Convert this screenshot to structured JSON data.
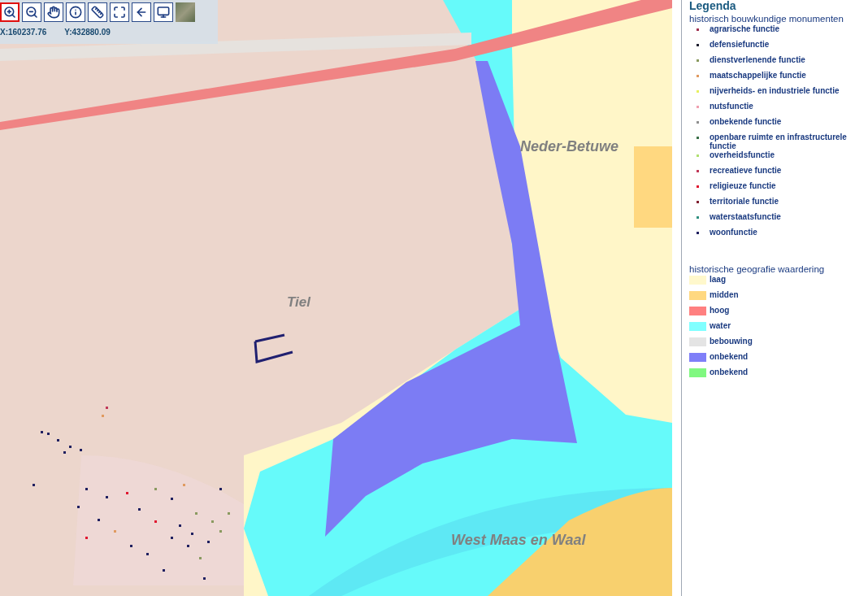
{
  "toolbar": {
    "tools": [
      {
        "kind": "zoom-in",
        "selected": true
      },
      {
        "kind": "zoom-out",
        "selected": false
      },
      {
        "kind": "pan",
        "selected": false
      },
      {
        "kind": "info",
        "selected": false
      },
      {
        "kind": "measure",
        "selected": false
      },
      {
        "kind": "full-extent",
        "selected": false
      },
      {
        "kind": "back",
        "selected": false
      },
      {
        "kind": "screen",
        "selected": false
      },
      {
        "kind": "aerial",
        "selected": false
      }
    ],
    "x_coordinate": "X:160237.76",
    "y_coordinate": "Y:432880.09"
  },
  "map": {
    "labels": [
      {
        "text": "Neder-Betuwe",
        "kind": "region"
      },
      {
        "text": "Tiel",
        "kind": "city"
      },
      {
        "text": "West Maas en Waal",
        "kind": "region"
      }
    ]
  },
  "legend": {
    "title": "Legenda",
    "sections": [
      {
        "title": "historisch bouwkundige monumenten",
        "kind": "dot",
        "items": [
          {
            "label": "agrarische functie",
            "color": "#a0304f"
          },
          {
            "label": "defensiefunctie",
            "color": "#202030"
          },
          {
            "label": "dienstverlenende functie",
            "color": "#8a9a60"
          },
          {
            "label": "maatschappelijke functie",
            "color": "#e09a60"
          },
          {
            "label": "nijverheids- en industriele functie",
            "color": "#e8f060"
          },
          {
            "label": "nutsfunctie",
            "color": "#f0a0b0"
          },
          {
            "label": "onbekende functie",
            "color": "#909090"
          },
          {
            "label": "openbare ruimte en infrastructurele functie",
            "color": "#3a7048"
          },
          {
            "label": "overheidsfunctie",
            "color": "#b0e070"
          },
          {
            "label": "recreatieve functie",
            "color": "#c03858"
          },
          {
            "label": "religieuze functie",
            "color": "#e01830"
          },
          {
            "label": "territoriale functie",
            "color": "#802030"
          },
          {
            "label": "waterstaatsfunctie",
            "color": "#309080"
          },
          {
            "label": "woonfunctie",
            "color": "#202060"
          }
        ]
      },
      {
        "title": "historische geografie waardering",
        "kind": "swatch",
        "items": [
          {
            "label": "laag",
            "color": "#fff8cc"
          },
          {
            "label": "midden",
            "color": "#ffd880"
          },
          {
            "label": "hoog",
            "color": "#ff8080"
          },
          {
            "label": "water",
            "color": "#80ffff"
          },
          {
            "label": "bebouwing",
            "color": "#e4e4e4"
          },
          {
            "label": "onbekend",
            "color": "#7f7ff8"
          },
          {
            "label": "onbekend",
            "color": "#80f880"
          }
        ]
      }
    ]
  }
}
